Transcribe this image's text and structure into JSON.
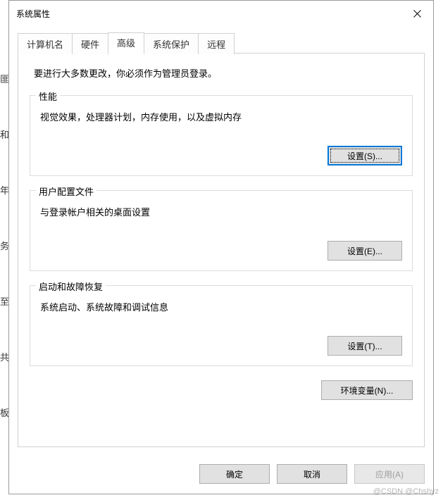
{
  "titlebar": {
    "title": "系统属性"
  },
  "tabs": {
    "computer_name": "计算机名",
    "hardware": "硬件",
    "advanced": "高级",
    "system_protection": "系统保护",
    "remote": "远程"
  },
  "panel": {
    "admin_note": "要进行大多数更改，你必须作为管理员登录。",
    "performance": {
      "title": "性能",
      "desc": "视觉效果，处理器计划，内存使用，以及虚拟内存",
      "settings_btn": "设置(S)..."
    },
    "user_profiles": {
      "title": "用户配置文件",
      "desc": "与登录帐户相关的桌面设置",
      "settings_btn": "设置(E)..."
    },
    "startup": {
      "title": "启动和故障恢复",
      "desc": "系统启动、系统故障和调试信息",
      "settings_btn": "设置(T)..."
    },
    "env_btn": "环境变量(N)..."
  },
  "buttons": {
    "ok": "确定",
    "cancel": "取消",
    "apply": "应用(A)"
  },
  "watermark": "@CSDN @Chshyz"
}
